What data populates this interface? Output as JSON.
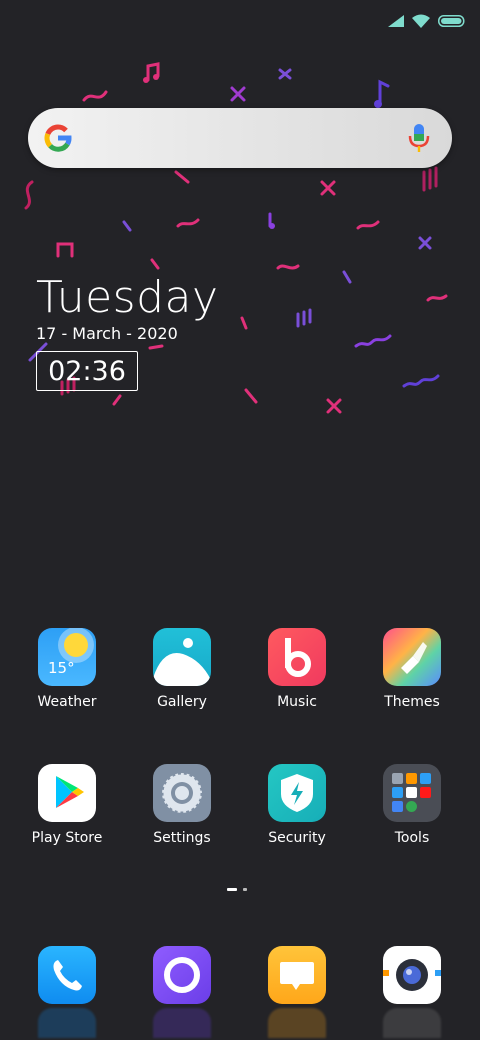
{
  "status_bar": {
    "icons": [
      "signal-icon",
      "wifi-icon",
      "battery-icon"
    ],
    "accent": "#7fdccd"
  },
  "search_bar": {
    "icons": [
      "google-g-icon",
      "mic-icon"
    ]
  },
  "widget": {
    "day": "Tuesday",
    "date": "17 - March - 2020",
    "time": "02:36"
  },
  "apps": [
    {
      "label": "Weather",
      "icon": "weather-icon",
      "temp": "15°"
    },
    {
      "label": "Gallery",
      "icon": "gallery-icon"
    },
    {
      "label": "Music",
      "icon": "music-icon"
    },
    {
      "label": "Themes",
      "icon": "themes-icon"
    },
    {
      "label": "Play Store",
      "icon": "play-store-icon"
    },
    {
      "label": "Settings",
      "icon": "settings-icon"
    },
    {
      "label": "Security",
      "icon": "security-icon"
    },
    {
      "label": "Tools",
      "icon": "tools-folder-icon"
    }
  ],
  "dock": [
    {
      "icon": "phone-icon"
    },
    {
      "icon": "browser-icon"
    },
    {
      "icon": "messages-icon"
    },
    {
      "icon": "camera-icon"
    }
  ],
  "colors": {
    "background": "#232327",
    "decoration_pink": "#e0307a",
    "decoration_purple": "#7a4fd8"
  }
}
